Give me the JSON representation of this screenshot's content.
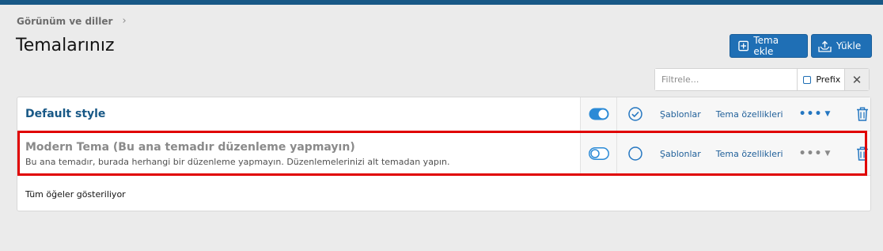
{
  "breadcrumb": {
    "label": "Görünüm ve diller",
    "chevron": "›"
  },
  "page": {
    "title": "Temalarınız"
  },
  "toolbar": {
    "add_label": "Tema ekle",
    "upload_label": "Yükle"
  },
  "filter": {
    "placeholder": "Filtrele...",
    "prefix_label": "Prefix",
    "clear_symbol": "✕"
  },
  "styles": [
    {
      "title": "Default style",
      "description": "",
      "enabled": true,
      "default": true,
      "templates_label": "Şablonlar",
      "properties_label": "Tema özellikleri",
      "more": "•••",
      "caret": "▼"
    },
    {
      "title": "Modern Tema (Bu ana temadır düzenleme yapmayın)",
      "description": "Bu ana temadır, burada herhangi bir düzenleme yapmayın. Düzenlemelerinizi alt temadan yapın.",
      "enabled": false,
      "default": false,
      "templates_label": "Şablonlar",
      "properties_label": "Tema özellikleri",
      "more": "•••",
      "caret": "▼"
    }
  ],
  "footer": {
    "status": "Tüm öğeler gösteriliyor"
  },
  "colors": {
    "accent": "#1f6fb5",
    "header_bar": "#185886",
    "title_link": "#185886",
    "highlight_border": "#e00000"
  }
}
